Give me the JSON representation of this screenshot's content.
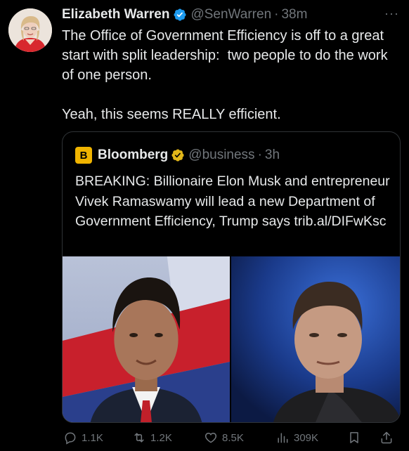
{
  "tweet": {
    "author_name": "Elizabeth Warren",
    "handle": "@SenWarren",
    "separator": "·",
    "time": "38m",
    "more_label": "···",
    "text": "The Office of Government Efficiency is off to a great start with split leadership:  two people to do the work of one person.\n\nYeah, this seems REALLY efficient."
  },
  "quote": {
    "logo_letter": "B",
    "author_name": "Bloomberg",
    "handle": "@business",
    "separator": "·",
    "time": "3h",
    "text": "BREAKING: Billionaire Elon Musk and entrepreneur Vivek Ramaswamy will lead a new Department of Government Efficiency, Trump says trib.al/DIFwKsc"
  },
  "actions": {
    "reply_count": "1.1K",
    "retweet_count": "1.2K",
    "like_count": "8.5K",
    "views_count": "309K"
  },
  "colors": {
    "background": "#000000",
    "text_primary": "#e7e9ea",
    "text_secondary": "#71767b",
    "verified_blue": "#1d9bf0",
    "verified_gold": "#e2b719",
    "border": "#2f3336"
  },
  "icons": {
    "verified": "verified-badge-icon",
    "gold_verified": "gold-verified-badge-icon",
    "reply": "reply-icon",
    "retweet": "retweet-icon",
    "like": "heart-icon",
    "views": "views-chart-icon",
    "bookmark": "bookmark-icon",
    "share": "share-icon"
  }
}
